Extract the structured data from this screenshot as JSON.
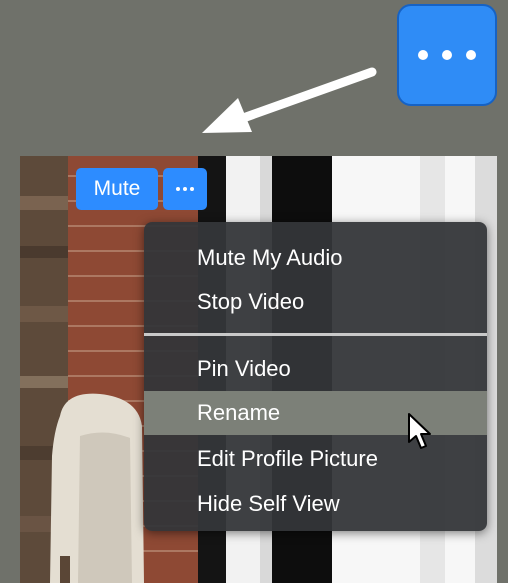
{
  "toolbar": {
    "mute_label": "Mute"
  },
  "context_menu": {
    "items": [
      {
        "label": "Mute My Audio"
      },
      {
        "label": "Stop Video"
      },
      {
        "label": "Pin Video"
      },
      {
        "label": "Rename"
      },
      {
        "label": "Edit Profile Picture"
      },
      {
        "label": "Hide Self View"
      }
    ],
    "hovered": "Rename"
  },
  "icons": {
    "more_large": "ellipsis-icon",
    "more_small": "ellipsis-icon",
    "pointer": "arrow-icon",
    "cursor": "mouse-cursor-icon"
  },
  "colors": {
    "background": "#6f716a",
    "accent_blue": "#2d8cff",
    "menu_bg": "#343639",
    "menu_hover": "#7c8078"
  }
}
